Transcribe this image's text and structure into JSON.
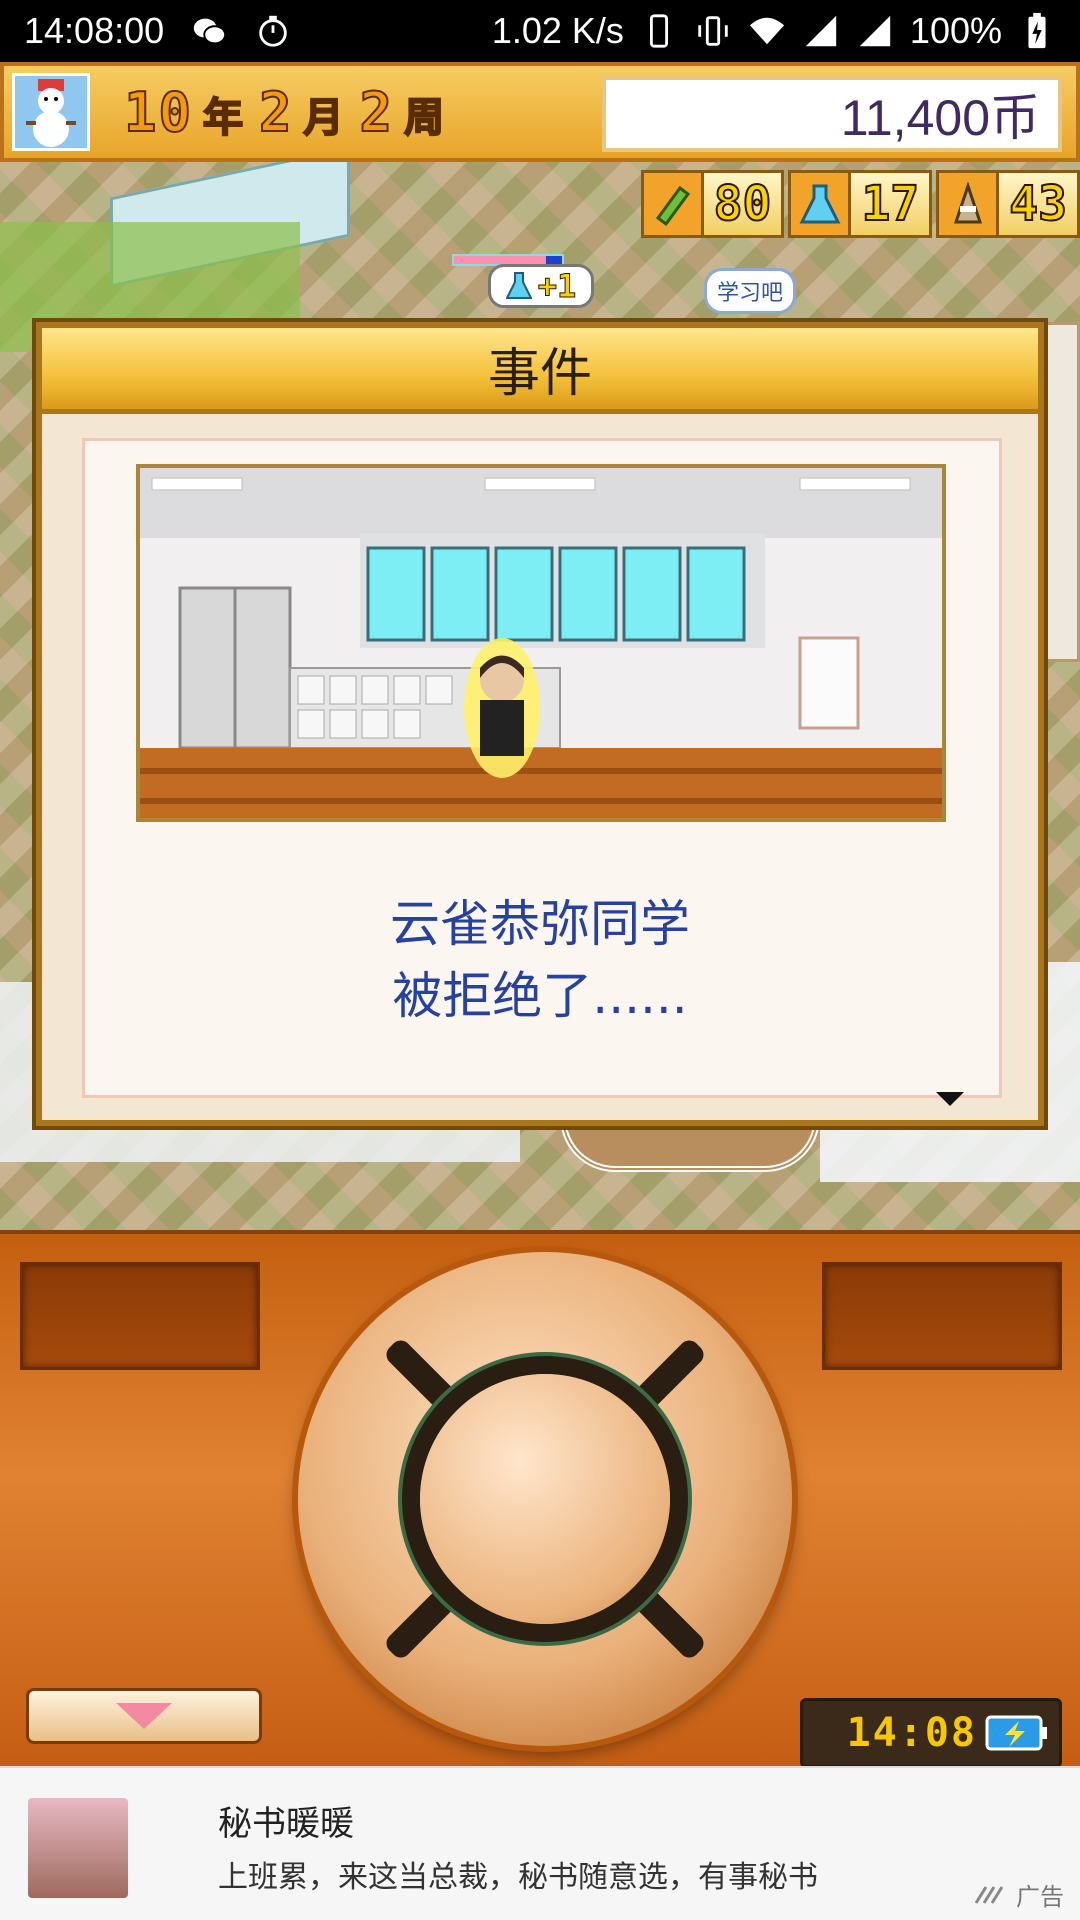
{
  "status_bar": {
    "time": "14:08:00",
    "net_speed": "1.02 K/s",
    "battery": "100%"
  },
  "header": {
    "year": "10",
    "year_unit": "年",
    "month": "2",
    "month_unit": "月",
    "week": "2",
    "week_unit": "周",
    "coins": "11,400币"
  },
  "stats": [
    {
      "icon": "pencil-icon",
      "value": "80"
    },
    {
      "icon": "flask-icon",
      "value": "17"
    },
    {
      "icon": "trophy-icon",
      "value": "43"
    }
  ],
  "map": {
    "study_bubble": "学习吧",
    "gain_value": "+1",
    "progress": 0.85
  },
  "dialog": {
    "title": "事件",
    "line1": "云雀恭弥同学",
    "line2": "被拒绝了......"
  },
  "controller": {
    "clock": "14:08"
  },
  "ad": {
    "title": "秘书暖暖",
    "description": "上班累，来这当总裁，秘书随意选，有事秘书",
    "tag": "广告"
  },
  "colors": {
    "header_bg": "#f0b84a",
    "dialog_title_bg": "#f4c13a",
    "message_text": "#2741a0",
    "controller_bg": "#e08232"
  }
}
